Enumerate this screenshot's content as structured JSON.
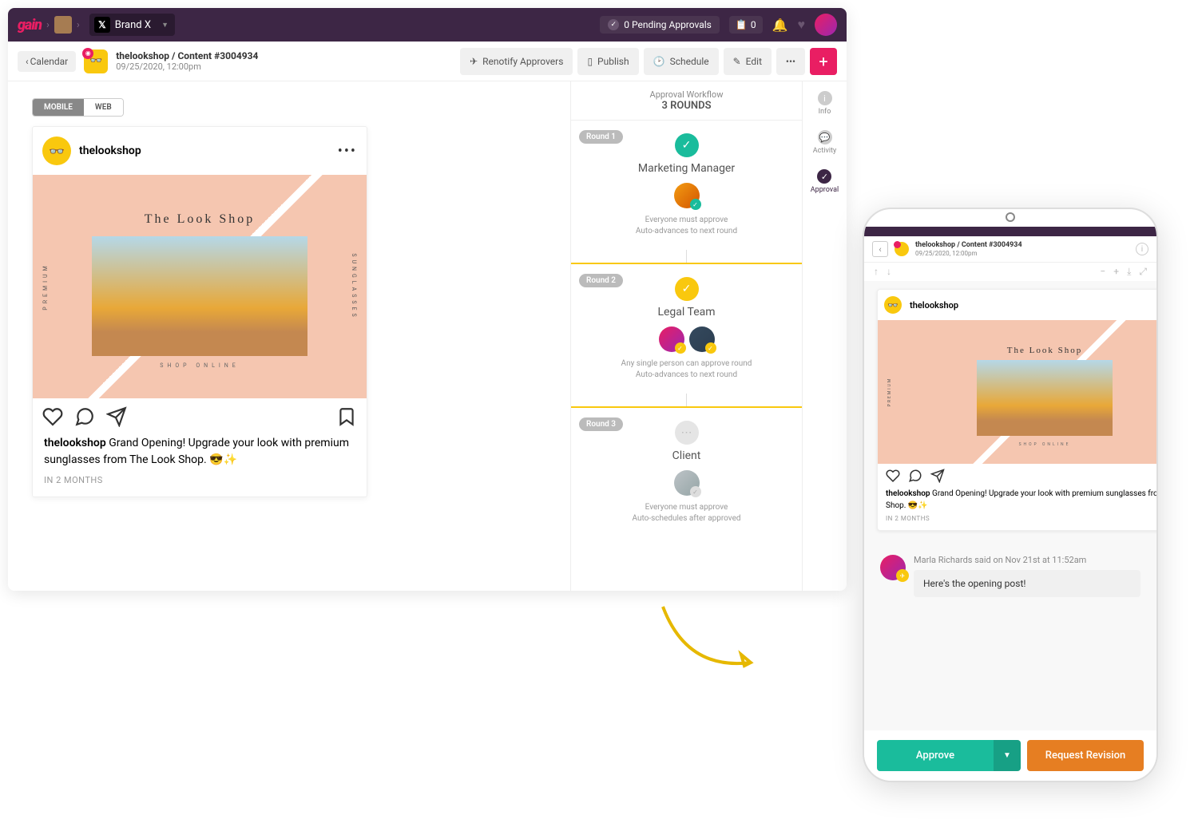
{
  "top": {
    "logo": "gain",
    "brand": "Brand X",
    "pending": "0 Pending Approvals",
    "clipboard_count": "0"
  },
  "sub": {
    "back": "Calendar",
    "channel_line": "thelookshop / Content #3004934",
    "channel_date": "09/25/2020, 12:00pm",
    "toolbar": {
      "renotify": "Renotify Approvers",
      "publish": "Publish",
      "schedule": "Schedule",
      "edit": "Edit"
    }
  },
  "toggle": {
    "mobile": "MOBILE",
    "web": "WEB"
  },
  "post": {
    "user": "thelookshop",
    "img_title": "The Look Shop",
    "img_tag": "SHOP ONLINE",
    "side_left": "PREMIUM",
    "side_right": "SUNGLASSES",
    "caption_bold": "thelookshop",
    "caption_text": " Grand Opening! Upgrade your look with premium sunglasses from The Look Shop. 😎✨",
    "time": "IN 2 MONTHS"
  },
  "workflow": {
    "title": "Approval Workflow",
    "rounds_label": "3 ROUNDS",
    "rounds": [
      {
        "pill": "Round 1",
        "name": "Marketing Manager",
        "rule1": "Everyone must approve",
        "rule2": "Auto-advances to next round",
        "status": "green"
      },
      {
        "pill": "Round 2",
        "name": "Legal Team",
        "rule1": "Any single person can approve round",
        "rule2": "Auto-advances to next round",
        "status": "yellow"
      },
      {
        "pill": "Round 3",
        "name": "Client",
        "rule1": "Everyone must approve",
        "rule2": "Auto-schedules after approved",
        "status": "grey"
      }
    ]
  },
  "rail": {
    "info": "Info",
    "activity": "Activity",
    "approval": "Approval"
  },
  "phone": {
    "comment_meta": "Marla Richards said on Nov 21st at 11:52am",
    "comment_text": "Here's the opening post!",
    "approve": "Approve",
    "revise": "Request Revision"
  }
}
